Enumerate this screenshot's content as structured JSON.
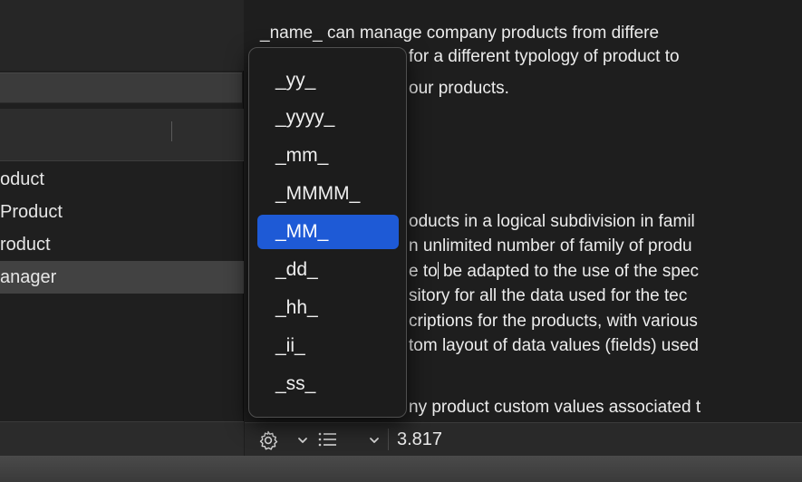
{
  "sidebar": {
    "items": [
      {
        "label": "oduct"
      },
      {
        "label": "Product"
      },
      {
        "label": "roduct"
      },
      {
        "label": "anager"
      }
    ],
    "selected_index": 3
  },
  "editor": {
    "lines": [
      "_name_ can manage company products from differe",
      "for a different typology of product to",
      "our products.",
      "oducts in a logical subdivision in famil",
      "n unlimited number of family of produ",
      "sitory for all the data used for the tec",
      "criptions for the products, with various",
      "tom layout of data values (fields) used",
      "ny product custom values associated t"
    ],
    "caret_line_before": "e to",
    "caret_line_after": " be adapted to the use of the spec"
  },
  "popup_menu": {
    "items": [
      "_yy_",
      "_yyyy_",
      "_mm_",
      "_MMMM_",
      "_MM_",
      "_dd_",
      "_hh_",
      "_ii_",
      "_ss_"
    ],
    "highlighted": "_MM_"
  },
  "statusbar": {
    "settings_icon": "gear-icon",
    "list_icon": "list-icon",
    "value": "3.817"
  },
  "colors": {
    "accent": "#1e5ad6",
    "background": "#1e1e1e",
    "text": "#ececec"
  }
}
